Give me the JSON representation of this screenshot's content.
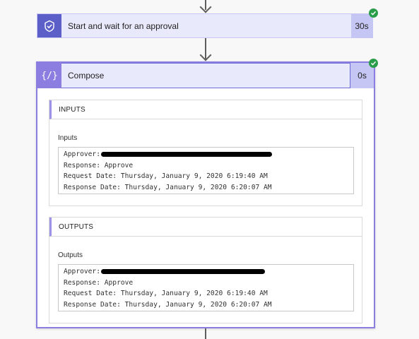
{
  "approval_step": {
    "title": "Start and wait for an approval",
    "duration": "30s",
    "status": "succeeded"
  },
  "compose_step": {
    "title": "Compose",
    "icon": "{/}",
    "duration": "0s",
    "status": "succeeded",
    "inputs": {
      "section_title": "INPUTS",
      "field_label": "Inputs",
      "lines": [
        "Approver:",
        "Response: Approve",
        "Request Date: Thursday, January 9, 2020 6:19:40 AM",
        "Response Date: Thursday, January 9, 2020 6:20:07 AM"
      ]
    },
    "outputs": {
      "section_title": "OUTPUTS",
      "field_label": "Outputs",
      "lines": [
        "Approver:",
        "Response: Approve",
        "Request Date: Thursday, January 9, 2020 6:19:40 AM",
        "Response Date: Thursday, January 9, 2020 6:20:07 AM"
      ]
    }
  },
  "colors": {
    "card_background": "#e9e9fc",
    "approval_icon": "#5b5fc7",
    "compose_icon": "#8c7ee0",
    "success_check": "#2a9d4a"
  }
}
